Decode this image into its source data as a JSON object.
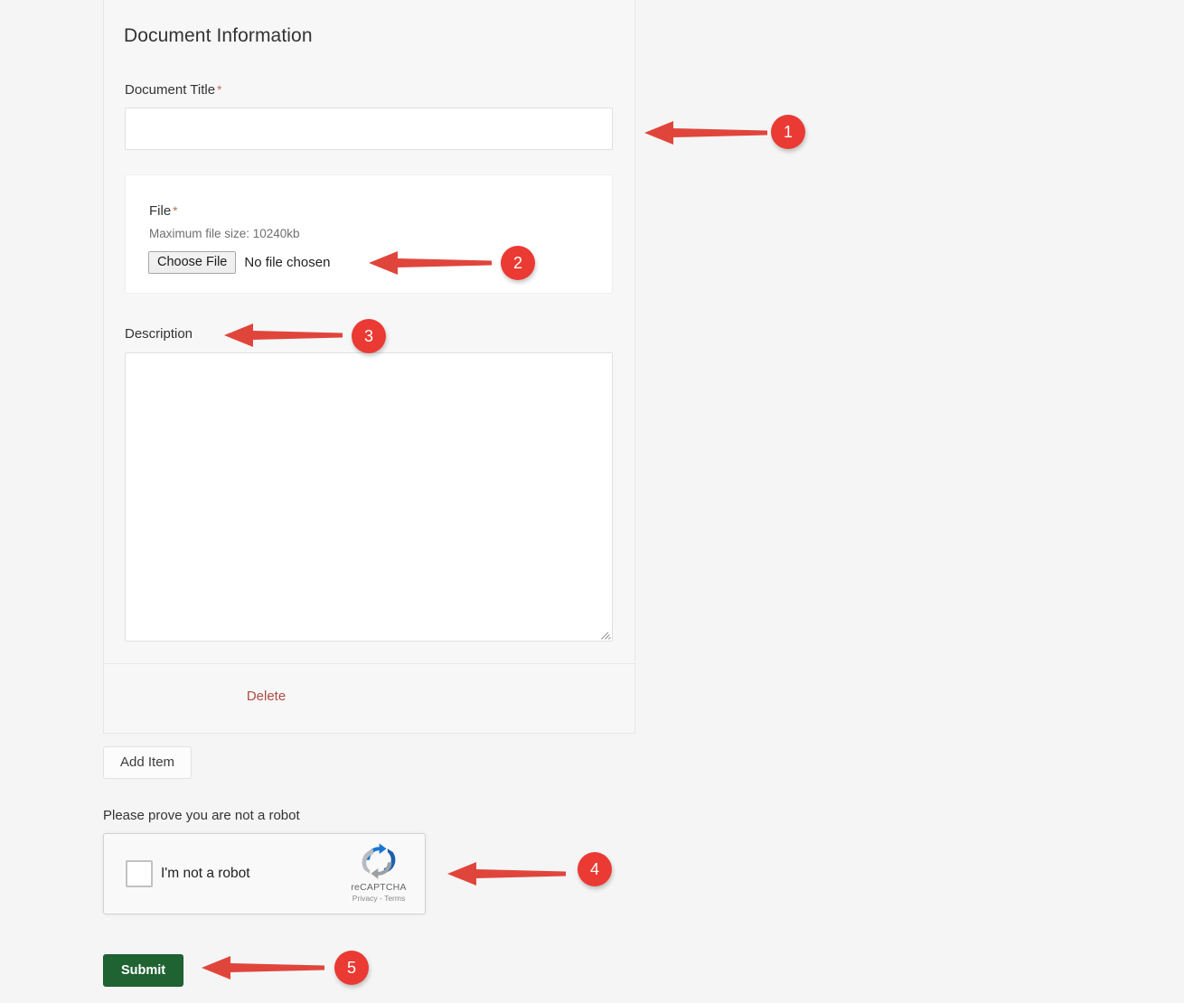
{
  "panel": {
    "heading": "Document Information"
  },
  "form": {
    "title_field": {
      "label": "Document Title",
      "required_marker": "*",
      "value": "",
      "placeholder": ""
    },
    "file_field": {
      "label": "File",
      "required_marker": "*",
      "max_size_text": "Maximum file size: 10240kb",
      "choose_button_label": "Choose File",
      "selected_file_text": "No file chosen"
    },
    "description_field": {
      "label": "Description",
      "value": "",
      "placeholder": ""
    },
    "delete_link_label": "Delete",
    "add_item_button_label": "Add Item"
  },
  "captcha": {
    "prompt": "Please prove you are not a robot",
    "checkbox_label": "I'm not a robot",
    "brand_name": "reCAPTCHA",
    "legal_text": "Privacy - Terms",
    "checked": false
  },
  "actions": {
    "submit_label": "Submit"
  },
  "colors": {
    "page_background": "#f5f5f5",
    "annotation_red": "#ea3a33",
    "delete_link": "#ac4c42",
    "submit_green": "#206333",
    "required_star": "#c0705c"
  },
  "annotations": [
    {
      "number": "1",
      "target": "document-title-input"
    },
    {
      "number": "2",
      "target": "choose-file-button"
    },
    {
      "number": "3",
      "target": "description-label"
    },
    {
      "number": "4",
      "target": "recaptcha-widget"
    },
    {
      "number": "5",
      "target": "submit-button"
    }
  ]
}
